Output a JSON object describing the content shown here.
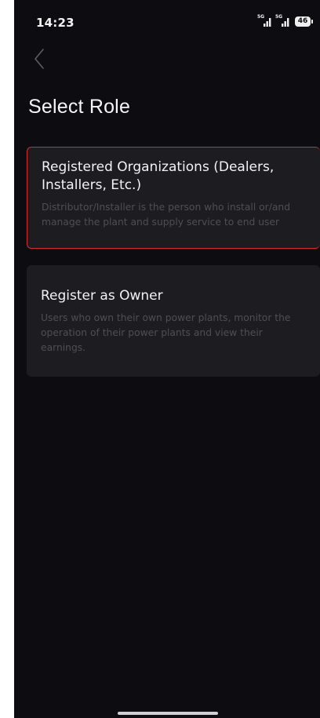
{
  "status_bar": {
    "time": "14:23",
    "network_1": "5G",
    "network_2": "5G",
    "battery_level": "46"
  },
  "header": {
    "back_icon": "chevron-left-icon",
    "title": "Select Role"
  },
  "roles": [
    {
      "title": "Registered Organizations (Dealers, Installers, Etc.)",
      "description": "Distributor/Installer is the person who install or/and manage the plant and supply service to end user",
      "selected": true
    },
    {
      "title": "Register as Owner",
      "description": "Users who own their own power plants, monitor the operation of their power plants and view their earnings.",
      "selected": false
    }
  ],
  "colors": {
    "background": "#0d0d11",
    "card": "#1c1c21",
    "selected_border": "#d92b2b",
    "title_text": "#f3f3f3",
    "description_text": "#4e4e55"
  }
}
